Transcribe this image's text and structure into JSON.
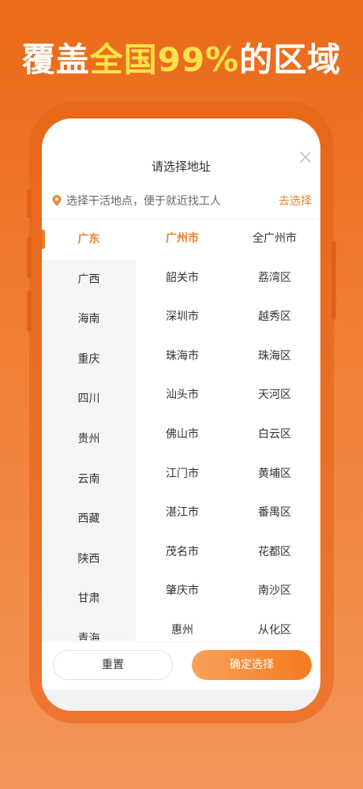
{
  "headline": {
    "prefix": "覆盖",
    "highlight": "全国99%",
    "suffix": "的区域"
  },
  "dialog": {
    "title": "请选择地址",
    "close_icon": "close-icon"
  },
  "location": {
    "hint": "选择干活地点，便于就近找工人",
    "link": "去选择",
    "icon": "map-pin-icon"
  },
  "provinces": [
    "广东",
    "广西",
    "海南",
    "重庆",
    "四川",
    "贵州",
    "云南",
    "西藏",
    "陕西",
    "甘肃",
    "青海"
  ],
  "cities": [
    "广州市",
    "韶关市",
    "深圳市",
    "珠海市",
    "汕头市",
    "佛山市",
    "江门市",
    "湛江市",
    "茂名市",
    "肇庆市",
    "惠州"
  ],
  "districts": [
    "全广州市",
    "荔湾区",
    "越秀区",
    "珠海区",
    "天河区",
    "白云区",
    "黄埔区",
    "番禺区",
    "花都区",
    "南沙区",
    "从化区"
  ],
  "selected": {
    "province": "广东",
    "city": "广州市"
  },
  "footer": {
    "reset": "重置",
    "confirm": "确定选择"
  },
  "colors": {
    "accent": "#f07f2a",
    "highlight": "#ffe14a",
    "background": "#ea6a1a"
  }
}
